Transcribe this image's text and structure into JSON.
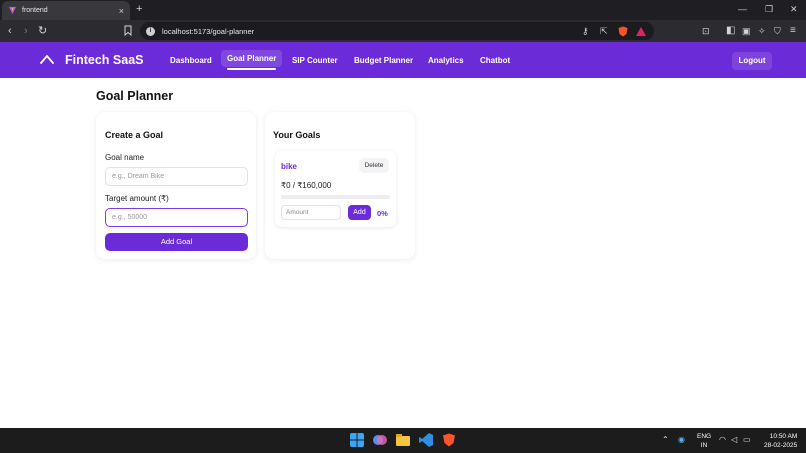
{
  "browser": {
    "tab_title": "frontend",
    "tab_close": "×",
    "new_tab": "+",
    "url": "localhost:5173/goal-planner",
    "win_min": "—",
    "win_max": "❐",
    "win_close": "✕"
  },
  "nav": {
    "brand": "Fintech SaaS",
    "links": [
      "Dashboard",
      "Goal Planner",
      "SIP Counter",
      "Budget Planner",
      "Analytics",
      "Chatbot"
    ],
    "active": "Goal Planner",
    "logout": "Logout",
    "accent": "#6c2bd9"
  },
  "page": {
    "title": "Goal Planner"
  },
  "create_goal": {
    "title": "Create a Goal",
    "goal_name_label": "Goal name",
    "goal_name_placeholder": "e.g., Dream Bike",
    "target_label": "Target amount (₹)",
    "target_placeholder": "e.g., 50000",
    "submit_label": "Add Goal"
  },
  "your_goals": {
    "title": "Your Goals",
    "goals": [
      {
        "name": "bike",
        "delete_label": "Delete",
        "progress_text": "₹0 / ₹160,000",
        "progress_fraction": 0,
        "amount_placeholder": "Amount",
        "add_label": "Add",
        "percent_label": "0%"
      }
    ]
  },
  "taskbar": {
    "lang_top": "ENG",
    "lang_bottom": "IN",
    "time": "10:50 AM",
    "date": "28-02-2025"
  }
}
